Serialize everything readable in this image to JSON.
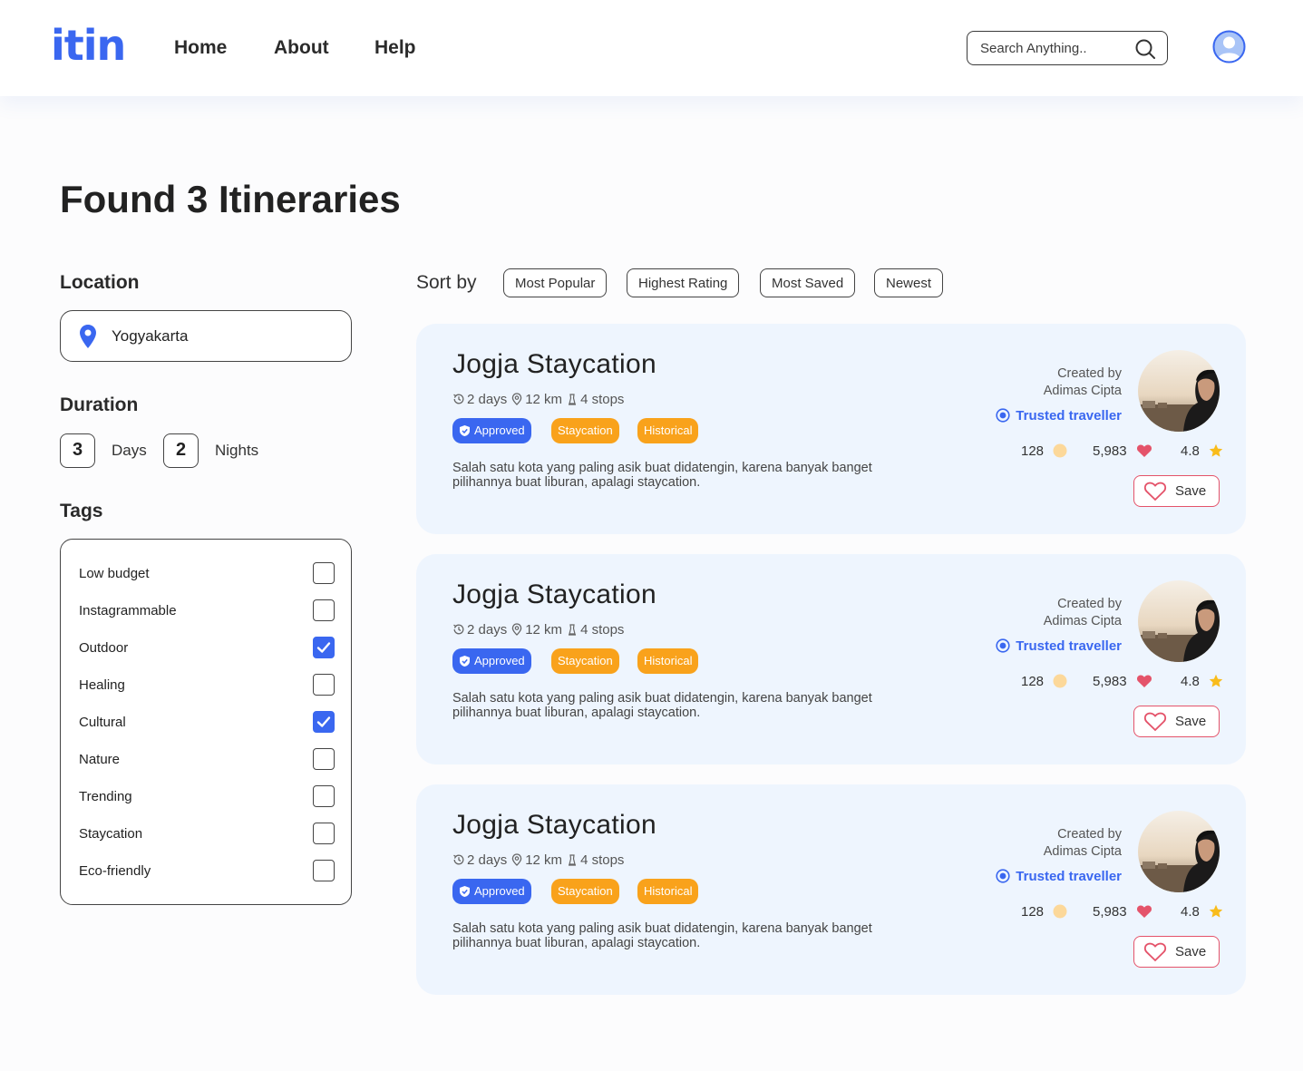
{
  "brand": {
    "logo": "itin",
    "accent": "#3a67f0",
    "orange": "#f9a21b",
    "heart": "#e4536a"
  },
  "nav": {
    "home": "Home",
    "about": "About",
    "help": "Help"
  },
  "search": {
    "placeholder": "Search Anything..",
    "icon": "search-icon"
  },
  "page": {
    "title": "Found 3 Itineraries"
  },
  "filters": {
    "location_heading": "Location",
    "location_value": "Yogyakarta",
    "duration_heading": "Duration",
    "days_value": "3",
    "days_label": "Days",
    "nights_value": "2",
    "nights_label": "Nights",
    "tags_heading": "Tags",
    "tags": [
      {
        "label": "Low budget",
        "checked": false
      },
      {
        "label": "Instagrammable",
        "checked": false
      },
      {
        "label": "Outdoor",
        "checked": true
      },
      {
        "label": "Healing",
        "checked": false
      },
      {
        "label": "Cultural",
        "checked": true
      },
      {
        "label": "Nature",
        "checked": false
      },
      {
        "label": "Trending",
        "checked": false
      },
      {
        "label": "Staycation",
        "checked": false
      },
      {
        "label": "Eco-friendly",
        "checked": false
      }
    ]
  },
  "sort": {
    "label": "Sort by",
    "options": [
      "Most Popular",
      "Highest Rating",
      "Most Saved",
      "Newest"
    ]
  },
  "results": [
    {
      "title": "Jogja Staycation",
      "days": "2 days",
      "distance": "12 km",
      "stops": "4 stops",
      "badges": [
        "Approved",
        "Staycation",
        "Historical"
      ],
      "description": "Salah satu kota yang paling asik buat didatengin, karena banyak banget pilihannya buat liburan, apalagi staycation.",
      "created_by_label": "Created by",
      "author": "Adimas Cipta",
      "trusted": "Trusted traveller",
      "comments": "128",
      "likes": "5,983",
      "rating": "4.8",
      "save_label": "Save"
    },
    {
      "title": "Jogja Staycation",
      "days": "2 days",
      "distance": "12 km",
      "stops": "4 stops",
      "badges": [
        "Approved",
        "Staycation",
        "Historical"
      ],
      "description": "Salah satu kota yang paling asik buat didatengin, karena banyak banget pilihannya buat liburan, apalagi staycation.",
      "created_by_label": "Created by",
      "author": "Adimas Cipta",
      "trusted": "Trusted traveller",
      "comments": "128",
      "likes": "5,983",
      "rating": "4.8",
      "save_label": "Save"
    },
    {
      "title": "Jogja Staycation",
      "days": "2 days",
      "distance": "12 km",
      "stops": "4 stops",
      "badges": [
        "Approved",
        "Staycation",
        "Historical"
      ],
      "description": "Salah satu kota yang paling asik buat didatengin, karena banyak banget pilihannya buat liburan, apalagi staycation.",
      "created_by_label": "Created by",
      "author": "Adimas Cipta",
      "trusted": "Trusted traveller",
      "comments": "128",
      "likes": "5,983",
      "rating": "4.8",
      "save_label": "Save"
    }
  ]
}
